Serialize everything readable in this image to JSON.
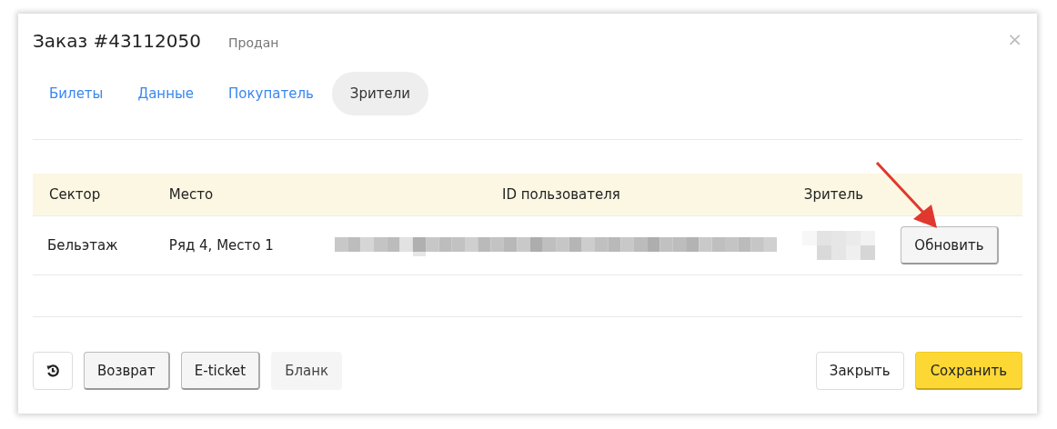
{
  "dialog": {
    "title": "Заказ #43112050",
    "status": "Продан",
    "close": "×"
  },
  "tabs": [
    {
      "label": "Билеты",
      "selected": false
    },
    {
      "label": "Данные",
      "selected": false
    },
    {
      "label": "Покупатель",
      "selected": false
    },
    {
      "label": "Зрители",
      "selected": true
    }
  ],
  "table": {
    "columns": [
      "Сектор",
      "Место",
      "ID пользователя",
      "Зритель"
    ],
    "rows": [
      {
        "sector": "Бельэтаж",
        "seat": "Ряд 4, Место 1",
        "action": "Обновить"
      }
    ]
  },
  "footer": {
    "left": [
      {
        "kind": "icon"
      },
      {
        "kind": "raised",
        "label": "Возврат"
      },
      {
        "kind": "raised",
        "label": "E-ticket"
      },
      {
        "kind": "flat",
        "label": "Бланк"
      }
    ],
    "right": [
      {
        "kind": "plain",
        "label": "Закрыть"
      },
      {
        "kind": "primary",
        "label": "Сохранить"
      }
    ]
  }
}
